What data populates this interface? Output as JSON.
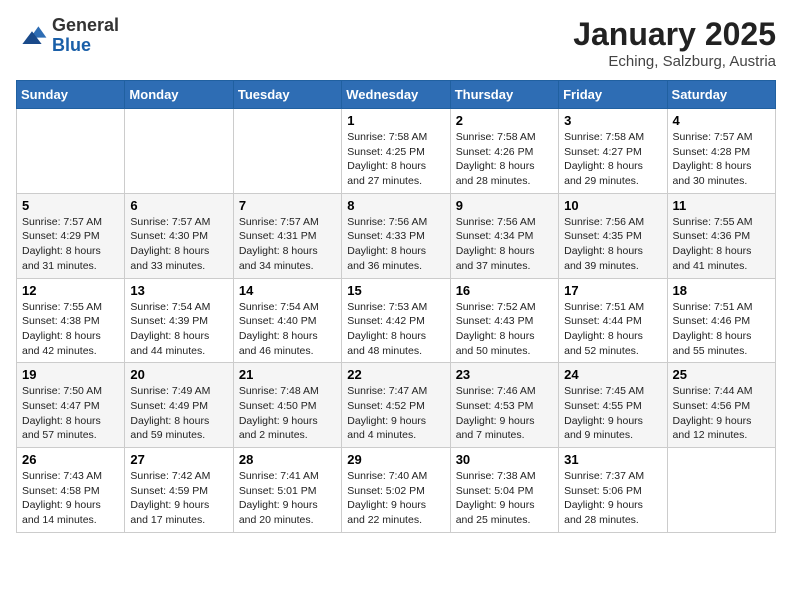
{
  "logo": {
    "general": "General",
    "blue": "Blue"
  },
  "header": {
    "title": "January 2025",
    "subtitle": "Eching, Salzburg, Austria"
  },
  "weekdays": [
    "Sunday",
    "Monday",
    "Tuesday",
    "Wednesday",
    "Thursday",
    "Friday",
    "Saturday"
  ],
  "weeks": [
    [
      {
        "day": "",
        "sunrise": "",
        "sunset": "",
        "daylight": ""
      },
      {
        "day": "",
        "sunrise": "",
        "sunset": "",
        "daylight": ""
      },
      {
        "day": "",
        "sunrise": "",
        "sunset": "",
        "daylight": ""
      },
      {
        "day": "1",
        "sunrise": "Sunrise: 7:58 AM",
        "sunset": "Sunset: 4:25 PM",
        "daylight": "Daylight: 8 hours and 27 minutes."
      },
      {
        "day": "2",
        "sunrise": "Sunrise: 7:58 AM",
        "sunset": "Sunset: 4:26 PM",
        "daylight": "Daylight: 8 hours and 28 minutes."
      },
      {
        "day": "3",
        "sunrise": "Sunrise: 7:58 AM",
        "sunset": "Sunset: 4:27 PM",
        "daylight": "Daylight: 8 hours and 29 minutes."
      },
      {
        "day": "4",
        "sunrise": "Sunrise: 7:57 AM",
        "sunset": "Sunset: 4:28 PM",
        "daylight": "Daylight: 8 hours and 30 minutes."
      }
    ],
    [
      {
        "day": "5",
        "sunrise": "Sunrise: 7:57 AM",
        "sunset": "Sunset: 4:29 PM",
        "daylight": "Daylight: 8 hours and 31 minutes."
      },
      {
        "day": "6",
        "sunrise": "Sunrise: 7:57 AM",
        "sunset": "Sunset: 4:30 PM",
        "daylight": "Daylight: 8 hours and 33 minutes."
      },
      {
        "day": "7",
        "sunrise": "Sunrise: 7:57 AM",
        "sunset": "Sunset: 4:31 PM",
        "daylight": "Daylight: 8 hours and 34 minutes."
      },
      {
        "day": "8",
        "sunrise": "Sunrise: 7:56 AM",
        "sunset": "Sunset: 4:33 PM",
        "daylight": "Daylight: 8 hours and 36 minutes."
      },
      {
        "day": "9",
        "sunrise": "Sunrise: 7:56 AM",
        "sunset": "Sunset: 4:34 PM",
        "daylight": "Daylight: 8 hours and 37 minutes."
      },
      {
        "day": "10",
        "sunrise": "Sunrise: 7:56 AM",
        "sunset": "Sunset: 4:35 PM",
        "daylight": "Daylight: 8 hours and 39 minutes."
      },
      {
        "day": "11",
        "sunrise": "Sunrise: 7:55 AM",
        "sunset": "Sunset: 4:36 PM",
        "daylight": "Daylight: 8 hours and 41 minutes."
      }
    ],
    [
      {
        "day": "12",
        "sunrise": "Sunrise: 7:55 AM",
        "sunset": "Sunset: 4:38 PM",
        "daylight": "Daylight: 8 hours and 42 minutes."
      },
      {
        "day": "13",
        "sunrise": "Sunrise: 7:54 AM",
        "sunset": "Sunset: 4:39 PM",
        "daylight": "Daylight: 8 hours and 44 minutes."
      },
      {
        "day": "14",
        "sunrise": "Sunrise: 7:54 AM",
        "sunset": "Sunset: 4:40 PM",
        "daylight": "Daylight: 8 hours and 46 minutes."
      },
      {
        "day": "15",
        "sunrise": "Sunrise: 7:53 AM",
        "sunset": "Sunset: 4:42 PM",
        "daylight": "Daylight: 8 hours and 48 minutes."
      },
      {
        "day": "16",
        "sunrise": "Sunrise: 7:52 AM",
        "sunset": "Sunset: 4:43 PM",
        "daylight": "Daylight: 8 hours and 50 minutes."
      },
      {
        "day": "17",
        "sunrise": "Sunrise: 7:51 AM",
        "sunset": "Sunset: 4:44 PM",
        "daylight": "Daylight: 8 hours and 52 minutes."
      },
      {
        "day": "18",
        "sunrise": "Sunrise: 7:51 AM",
        "sunset": "Sunset: 4:46 PM",
        "daylight": "Daylight: 8 hours and 55 minutes."
      }
    ],
    [
      {
        "day": "19",
        "sunrise": "Sunrise: 7:50 AM",
        "sunset": "Sunset: 4:47 PM",
        "daylight": "Daylight: 8 hours and 57 minutes."
      },
      {
        "day": "20",
        "sunrise": "Sunrise: 7:49 AM",
        "sunset": "Sunset: 4:49 PM",
        "daylight": "Daylight: 8 hours and 59 minutes."
      },
      {
        "day": "21",
        "sunrise": "Sunrise: 7:48 AM",
        "sunset": "Sunset: 4:50 PM",
        "daylight": "Daylight: 9 hours and 2 minutes."
      },
      {
        "day": "22",
        "sunrise": "Sunrise: 7:47 AM",
        "sunset": "Sunset: 4:52 PM",
        "daylight": "Daylight: 9 hours and 4 minutes."
      },
      {
        "day": "23",
        "sunrise": "Sunrise: 7:46 AM",
        "sunset": "Sunset: 4:53 PM",
        "daylight": "Daylight: 9 hours and 7 minutes."
      },
      {
        "day": "24",
        "sunrise": "Sunrise: 7:45 AM",
        "sunset": "Sunset: 4:55 PM",
        "daylight": "Daylight: 9 hours and 9 minutes."
      },
      {
        "day": "25",
        "sunrise": "Sunrise: 7:44 AM",
        "sunset": "Sunset: 4:56 PM",
        "daylight": "Daylight: 9 hours and 12 minutes."
      }
    ],
    [
      {
        "day": "26",
        "sunrise": "Sunrise: 7:43 AM",
        "sunset": "Sunset: 4:58 PM",
        "daylight": "Daylight: 9 hours and 14 minutes."
      },
      {
        "day": "27",
        "sunrise": "Sunrise: 7:42 AM",
        "sunset": "Sunset: 4:59 PM",
        "daylight": "Daylight: 9 hours and 17 minutes."
      },
      {
        "day": "28",
        "sunrise": "Sunrise: 7:41 AM",
        "sunset": "Sunset: 5:01 PM",
        "daylight": "Daylight: 9 hours and 20 minutes."
      },
      {
        "day": "29",
        "sunrise": "Sunrise: 7:40 AM",
        "sunset": "Sunset: 5:02 PM",
        "daylight": "Daylight: 9 hours and 22 minutes."
      },
      {
        "day": "30",
        "sunrise": "Sunrise: 7:38 AM",
        "sunset": "Sunset: 5:04 PM",
        "daylight": "Daylight: 9 hours and 25 minutes."
      },
      {
        "day": "31",
        "sunrise": "Sunrise: 7:37 AM",
        "sunset": "Sunset: 5:06 PM",
        "daylight": "Daylight: 9 hours and 28 minutes."
      },
      {
        "day": "",
        "sunrise": "",
        "sunset": "",
        "daylight": ""
      }
    ]
  ]
}
